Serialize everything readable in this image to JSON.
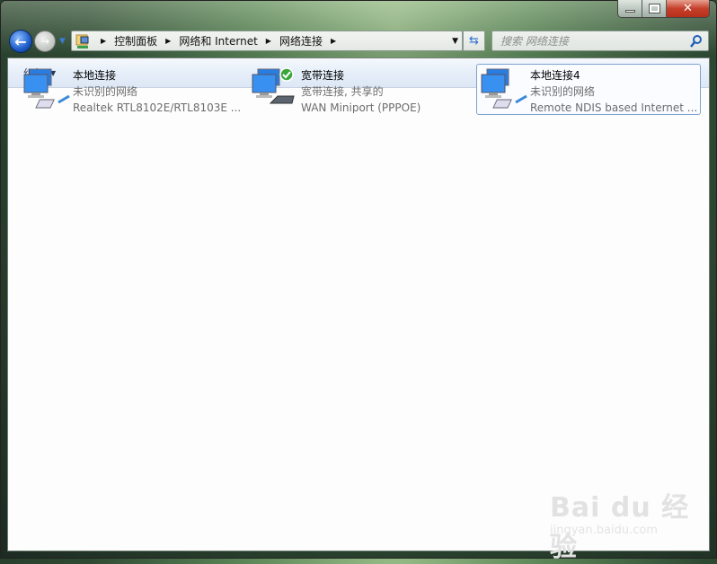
{
  "window": {
    "minimize": "—",
    "maximize": "□",
    "close": "X"
  },
  "address": {
    "crumbs": [
      "控制面板",
      "网络和 Internet",
      "网络连接"
    ]
  },
  "search": {
    "placeholder": "搜索 网络连接"
  },
  "toolbar": {
    "organize": "组织"
  },
  "connections": [
    {
      "name": "本地连接",
      "status": "未识别的网络",
      "device": "Realtek RTL8102E/RTL8103E ...",
      "type": "lan",
      "selected": false
    },
    {
      "name": "宽带连接",
      "status": "宽带连接, 共享的",
      "device": "WAN Miniport (PPPOE)",
      "type": "broadband",
      "connected": true,
      "selected": false
    },
    {
      "name": "本地连接4",
      "status": "未识别的网络",
      "device": "Remote NDIS based Internet ...",
      "type": "lan",
      "selected": true
    }
  ],
  "watermark": {
    "brand": "Bai du 经验",
    "url": "jingyan.baidu.com"
  }
}
